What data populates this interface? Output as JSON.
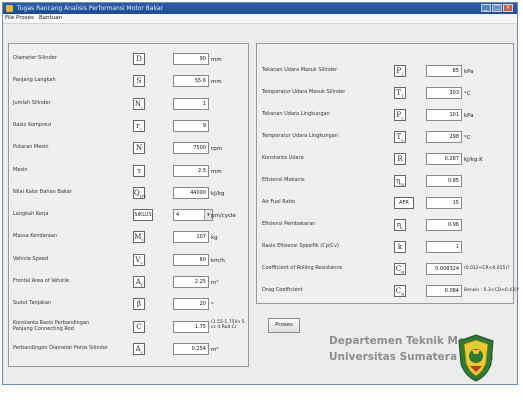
{
  "window": {
    "title": "Tugas Rancang Analisis Performansi Motor Bakar",
    "menu": [
      "File",
      "Proses",
      "Bantuan"
    ]
  },
  "left_rows": [
    {
      "label": "Diameter Silinder",
      "symbol": "D",
      "value": "90",
      "unit": "mm"
    },
    {
      "label": "Panjang Langkah",
      "symbol": "S",
      "value": "55.6",
      "unit": "mm"
    },
    {
      "label": "Jumlah Silinder",
      "symbol": "Nc",
      "value": "1",
      "unit": ""
    },
    {
      "label": "Rasio Kompresi",
      "symbol": "rc",
      "value": "9",
      "unit": ""
    },
    {
      "label": "Putaran Mesin",
      "symbol": "N",
      "value": "7500",
      "unit": "rpm"
    },
    {
      "label": "Mesin",
      "symbol": "τ",
      "value": "2.5",
      "unit": "mm"
    },
    {
      "label": "Nilai Kalor Bahan Bakar",
      "symbol": "Q_HV",
      "value": "44000",
      "unit": "kJ/kg"
    },
    {
      "label": "Langkah Kerja",
      "symbol": "SIKLUS",
      "value": "4",
      "unit": "pm/cycle"
    },
    {
      "label": "Massa Kendaraan",
      "symbol": "Mv",
      "value": "107",
      "unit": "kg"
    },
    {
      "label": "Vehicle Speed",
      "symbol": "Vv",
      "value": "60",
      "unit": "km/h"
    },
    {
      "label": "Frontal Area of Vehicle",
      "symbol": "Af",
      "value": "2.25",
      "unit": "m²"
    },
    {
      "label": "Sudut Tanjakan",
      "symbol": "β",
      "value": "20",
      "unit": "°"
    },
    {
      "label": "Konstanta Rasio Perbandingan Panjang Connecting Rod",
      "symbol": "C",
      "value": "1.75",
      "unit": "",
      "note": "(1.55-1.75)in 5 cc 4 Rod Cr"
    },
    {
      "label": "Perbandingan Diameter Poros Silinder",
      "symbol": "As",
      "value": "0.254",
      "unit": "m²"
    }
  ],
  "right_rows": [
    {
      "label": "Tekanan Udara Masuk Silinder",
      "symbol": "P1",
      "value": "85",
      "unit": "kPa"
    },
    {
      "label": "Temperatur Udara Masuk Silinder",
      "symbol": "T1",
      "value": "303",
      "unit": "°C"
    },
    {
      "label": "Tekanan Udara Lingkungan",
      "symbol": "Po",
      "value": "101",
      "unit": "kPa"
    },
    {
      "label": "Temperatur Udara Lingkungan",
      "symbol": "To",
      "value": "298",
      "unit": "°C"
    },
    {
      "label": "Konstanta Udara",
      "symbol": "R",
      "value": "0.287",
      "unit": "kJ/kg.K"
    },
    {
      "label": "Efisiensi Mekanis",
      "symbol": "ηm",
      "value": "0.85",
      "unit": ""
    },
    {
      "label": "Air Fuel Ratio",
      "symbol": "AFR",
      "value": "15",
      "unit": ""
    },
    {
      "label": "Efisiensi Pembakaran",
      "symbol": "ηc",
      "value": "0.96",
      "unit": ""
    },
    {
      "label": "Rasio Efisiensi Spesifik (Cp/Cv)",
      "symbol": "k",
      "value": "1",
      "unit": ""
    },
    {
      "label": "Coefficient of Rolling Resistance",
      "symbol": "CR",
      "value": "0.008324",
      "unit": "",
      "note": "(0.012<CR<0.015)?"
    },
    {
      "label": "Drag Coefficient",
      "symbol": "CD",
      "value": "0.084",
      "unit": "",
      "note": "Bensin : 0.3<CD<0.43)?"
    }
  ],
  "buttons": {
    "proses": "Proses"
  },
  "footer": {
    "line1": "Departemen Teknik Mesin",
    "line2": "Universitas Sumatera Utara"
  }
}
